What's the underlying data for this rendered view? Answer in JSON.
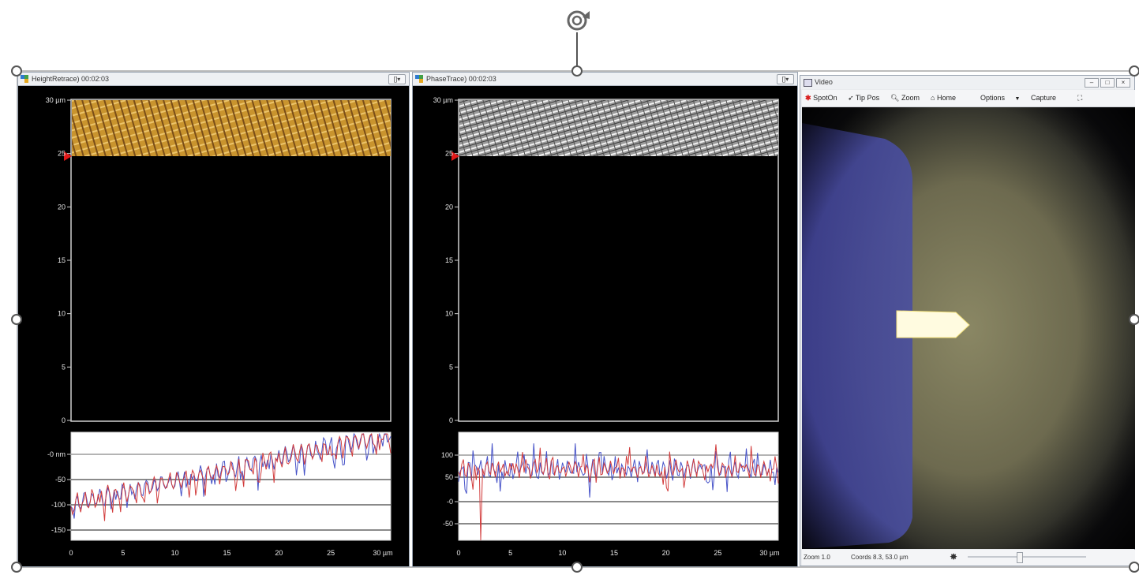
{
  "panels": {
    "height": {
      "title": "HeightRetrace) 00:02:03",
      "btn": "[]▾",
      "image_axis": {
        "ticks": [
          "30 µm",
          "25",
          "20",
          "15",
          "10",
          "5",
          "0"
        ]
      },
      "profile_axis": {
        "y_ticks": [
          "-0 nm",
          "-50",
          "-100",
          "-150"
        ],
        "x_ticks": [
          "0",
          "5",
          "10",
          "15",
          "20",
          "25",
          "30 µm"
        ]
      }
    },
    "phase": {
      "title": "PhaseTrace) 00:02:03",
      "btn": "[]▾",
      "image_axis": {
        "ticks": [
          "30 µm",
          "25",
          "20",
          "15",
          "10",
          "5",
          "0"
        ]
      },
      "profile_axis": {
        "y_ticks": [
          "100",
          "50",
          "-0",
          "-50"
        ],
        "x_ticks": [
          "0",
          "5",
          "10",
          "15",
          "20",
          "25",
          "30 µm"
        ]
      }
    }
  },
  "video": {
    "title": "Video",
    "toolbar": {
      "spoton": "SpotOn",
      "tippos": "Tip Pos",
      "zoom": "Zoom",
      "home": "Home",
      "options": "Options",
      "capture": "Capture"
    },
    "status": {
      "zoom": "Zoom 1.0",
      "coords": "Coords 8.3, 53.0 µm"
    }
  },
  "colors": {
    "trace": "#4652c8",
    "retrace": "#d23c3c",
    "scan_gold": "#c9942e",
    "marker": "#e01818"
  },
  "icons": [
    "rotate-icon",
    "spoton-icon",
    "tip-pos-icon",
    "zoom-icon",
    "home-icon",
    "chevron-down-icon",
    "fullscreen-icon",
    "brightness-icon",
    "app-icon"
  ]
}
